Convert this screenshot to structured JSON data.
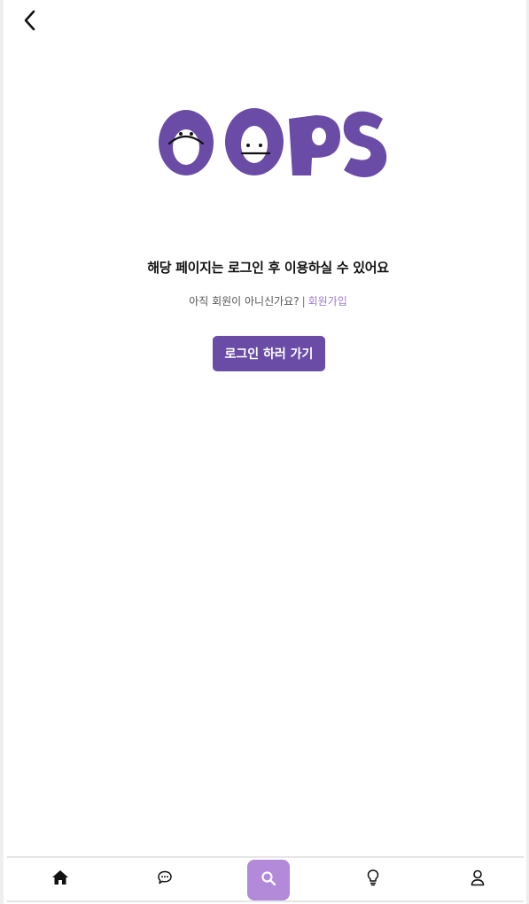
{
  "header": {
    "back_icon": "chevron-left-icon"
  },
  "logo": {
    "text": "OOPS",
    "color": "#6a4ca7"
  },
  "main": {
    "title": "해당 페이지는 로그인 후 이용하실 수 있어요",
    "prompt": "아직 회원이 아니신가요?",
    "separator": "|",
    "signup_link": "회원가입",
    "login_button": "로그인 하러 가기"
  },
  "colors": {
    "accent": "#6a4ca7",
    "link": "#9b7bd1",
    "active_nav": "#b28ad9"
  },
  "bottom_nav": {
    "items": [
      {
        "icon": "home-icon",
        "active": false
      },
      {
        "icon": "chat-icon",
        "active": false
      },
      {
        "icon": "search-icon",
        "active": true
      },
      {
        "icon": "lightbulb-icon",
        "active": false
      },
      {
        "icon": "user-icon",
        "active": false
      }
    ]
  }
}
